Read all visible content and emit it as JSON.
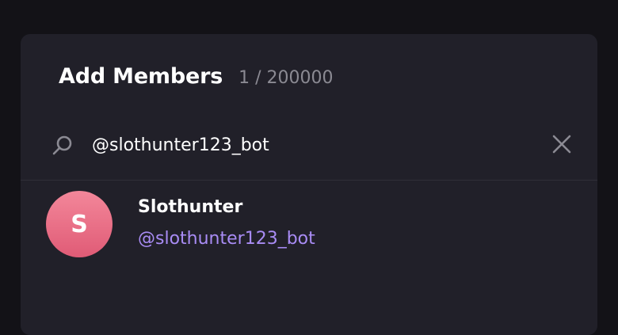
{
  "dialog": {
    "title": "Add Members",
    "member_count": "1 / 200000"
  },
  "search": {
    "value": "@slothunter123_bot",
    "icon": "search-icon",
    "clear_icon": "close-icon"
  },
  "results": [
    {
      "avatar_initial": "S",
      "name": "Slothunter",
      "username": "@slothunter123_bot",
      "avatar_color": "#e8677f"
    }
  ],
  "colors": {
    "background": "#131217",
    "dialog": "#212029",
    "accent_username": "#a98cf5",
    "muted_text": "#8b8a93"
  }
}
